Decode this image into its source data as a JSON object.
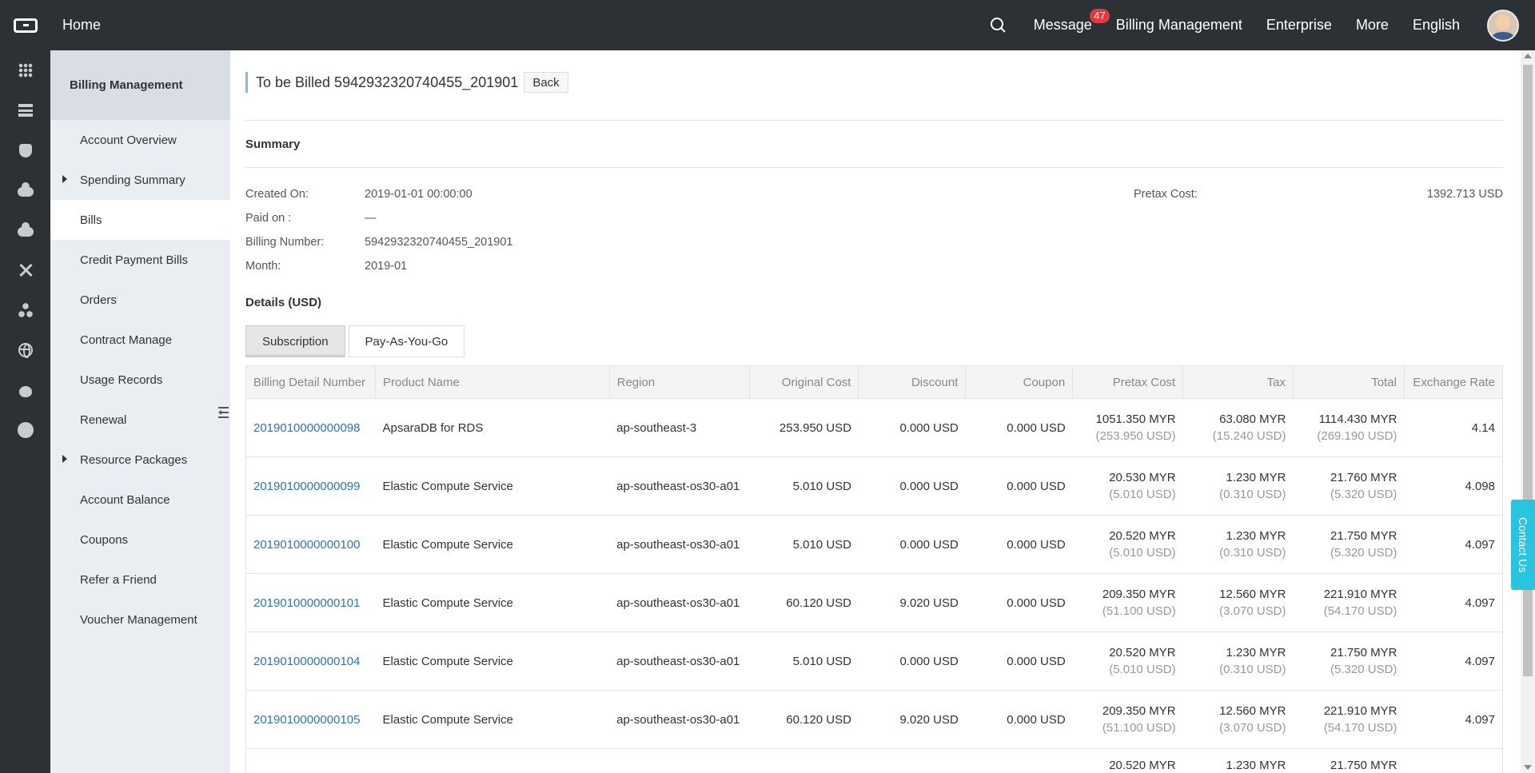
{
  "topbar": {
    "home": "Home",
    "message": "Message",
    "message_count": "47",
    "billing": "Billing Management",
    "enterprise": "Enterprise",
    "more": "More",
    "language": "English"
  },
  "rail_icons": [
    "grid-icon",
    "server-icon",
    "shield-icon",
    "cloud-icon",
    "cloud-upload-icon",
    "cross-icon",
    "nodes-icon",
    "globe-icon",
    "bug-icon",
    "circle-icon"
  ],
  "sidebar": {
    "title": "Billing Management",
    "items": [
      {
        "label": "Account Overview",
        "caret": false,
        "active": false
      },
      {
        "label": "Spending Summary",
        "caret": true,
        "active": false
      },
      {
        "label": "Bills",
        "caret": false,
        "active": true
      },
      {
        "label": "Credit Payment Bills",
        "caret": false,
        "active": false
      },
      {
        "label": "Orders",
        "caret": false,
        "active": false
      },
      {
        "label": "Contract Manage",
        "caret": false,
        "active": false
      },
      {
        "label": "Usage Records",
        "caret": false,
        "active": false
      },
      {
        "label": "Renewal",
        "caret": false,
        "active": false
      },
      {
        "label": "Resource Packages",
        "caret": true,
        "active": false
      },
      {
        "label": "Account Balance",
        "caret": false,
        "active": false
      },
      {
        "label": "Coupons",
        "caret": false,
        "active": false
      },
      {
        "label": "Refer a Friend",
        "caret": false,
        "active": false
      },
      {
        "label": "Voucher Management",
        "caret": false,
        "active": false
      }
    ]
  },
  "page": {
    "title": "To be Billed 5942932320740455_201901",
    "back": "Back"
  },
  "summary": {
    "title": "Summary",
    "created_label": "Created On:",
    "created_value": "2019-01-01 00:00:00",
    "paid_label": "Paid on :",
    "paid_value": "—",
    "billing_label": "Billing Number:",
    "billing_value": "5942932320740455_201901",
    "month_label": "Month:",
    "month_value": "2019-01",
    "pretax_label": "Pretax Cost:",
    "pretax_value": "1392.713 USD"
  },
  "details": {
    "title": "Details (USD)",
    "tabs": [
      "Subscription",
      "Pay-As-You-Go"
    ],
    "columns": [
      "Billing Detail Number",
      "Product Name",
      "Region",
      "Original Cost",
      "Discount",
      "Coupon",
      "Pretax Cost",
      "Tax",
      "Total",
      "Exchange Rate"
    ],
    "rows": [
      {
        "number": "2019010000000098",
        "product": "ApsaraDB for RDS",
        "region": "ap-southeast-3",
        "original": "253.950 USD",
        "discount": "0.000 USD",
        "coupon": "0.000 USD",
        "pretax": "1051.350 MYR",
        "pretax_usd": "(253.950 USD)",
        "tax": "63.080 MYR",
        "tax_usd": "(15.240 USD)",
        "total": "1114.430 MYR",
        "total_usd": "(269.190 USD)",
        "rate": "4.14"
      },
      {
        "number": "2019010000000099",
        "product": "Elastic Compute Service",
        "region": "ap-southeast-os30-a01",
        "original": "5.010 USD",
        "discount": "0.000 USD",
        "coupon": "0.000 USD",
        "pretax": "20.530 MYR",
        "pretax_usd": "(5.010 USD)",
        "tax": "1.230 MYR",
        "tax_usd": "(0.310 USD)",
        "total": "21.760 MYR",
        "total_usd": "(5.320 USD)",
        "rate": "4.098"
      },
      {
        "number": "2019010000000100",
        "product": "Elastic Compute Service",
        "region": "ap-southeast-os30-a01",
        "original": "5.010 USD",
        "discount": "0.000 USD",
        "coupon": "0.000 USD",
        "pretax": "20.520 MYR",
        "pretax_usd": "(5.010 USD)",
        "tax": "1.230 MYR",
        "tax_usd": "(0.310 USD)",
        "total": "21.750 MYR",
        "total_usd": "(5.320 USD)",
        "rate": "4.097"
      },
      {
        "number": "2019010000000101",
        "product": "Elastic Compute Service",
        "region": "ap-southeast-os30-a01",
        "original": "60.120 USD",
        "discount": "9.020 USD",
        "coupon": "0.000 USD",
        "pretax": "209.350 MYR",
        "pretax_usd": "(51.100 USD)",
        "tax": "12.560 MYR",
        "tax_usd": "(3.070 USD)",
        "total": "221.910 MYR",
        "total_usd": "(54.170 USD)",
        "rate": "4.097"
      },
      {
        "number": "2019010000000104",
        "product": "Elastic Compute Service",
        "region": "ap-southeast-os30-a01",
        "original": "5.010 USD",
        "discount": "0.000 USD",
        "coupon": "0.000 USD",
        "pretax": "20.520 MYR",
        "pretax_usd": "(5.010 USD)",
        "tax": "1.230 MYR",
        "tax_usd": "(0.310 USD)",
        "total": "21.750 MYR",
        "total_usd": "(5.320 USD)",
        "rate": "4.097"
      },
      {
        "number": "2019010000000105",
        "product": "Elastic Compute Service",
        "region": "ap-southeast-os30-a01",
        "original": "60.120 USD",
        "discount": "9.020 USD",
        "coupon": "0.000 USD",
        "pretax": "209.350 MYR",
        "pretax_usd": "(51.100 USD)",
        "tax": "12.560 MYR",
        "tax_usd": "(3.070 USD)",
        "total": "221.910 MYR",
        "total_usd": "(54.170 USD)",
        "rate": "4.097"
      }
    ],
    "partial_row": {
      "pretax": "20.520 MYR",
      "tax": "1.230 MYR",
      "total": "21.750 MYR"
    }
  },
  "contact": "Contact Us"
}
